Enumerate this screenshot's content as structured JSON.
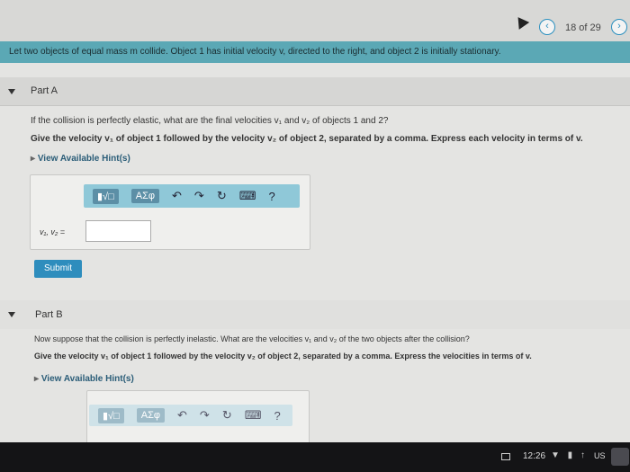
{
  "nav": {
    "prev_icon": "chevron-left",
    "next_icon": "chevron-right",
    "page_count": "18 of 29"
  },
  "intro": "Let two objects of equal mass m collide. Object 1 has initial velocity v, directed to the right, and object 2 is initially stationary.",
  "part_a": {
    "label": "Part A",
    "question": "If the collision is perfectly elastic, what are the final velocities v₁ and v₂ of objects 1 and 2?",
    "instruction": "Give the velocity v₁ of object 1 followed by the velocity v₂ of object 2, separated by a comma. Express each velocity in terms of v.",
    "hint": "View Available Hint(s)",
    "toolbar": {
      "templates": "▮√□",
      "greek": "ΑΣφ",
      "help": "?"
    },
    "answer_label": "v₁, v₂ =",
    "answer_value": "",
    "submit": "Submit"
  },
  "part_b": {
    "label": "Part B",
    "question": "Now suppose that the collision is perfectly inelastic. What are the velocities v₁ and v₂ of the two objects after the collision?",
    "instruction": "Give the velocity v₁ of object 1 followed by the velocity v₂ of object 2, separated by a comma. Express the velocities in terms of v.",
    "hint": "View Available Hint(s)",
    "toolbar": {
      "templates": "▮√□",
      "greek": "ΑΣφ",
      "help": "?"
    }
  },
  "taskbar": {
    "clock": "12:26",
    "status_icons": "▼ ▮ ↑",
    "lang": "US"
  },
  "colors": {
    "intro_bar": "#5ba8b5",
    "toolbar": "#8fc8d8",
    "submit": "#2e8dbd",
    "accent": "#2a8fbf"
  }
}
